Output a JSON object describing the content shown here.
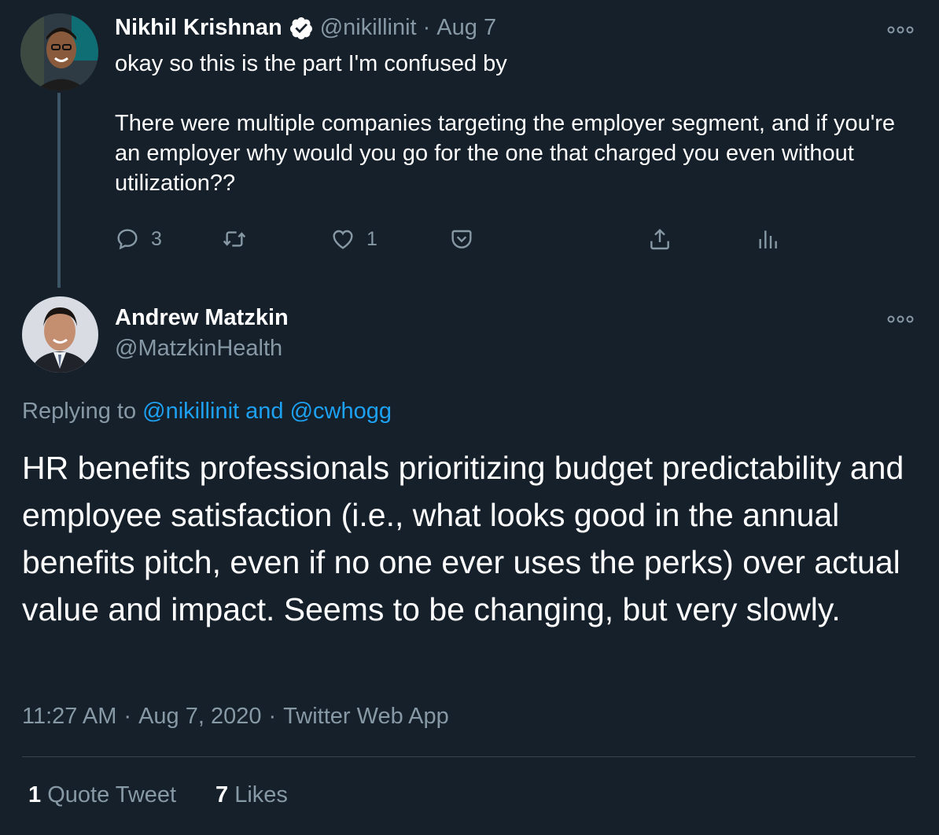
{
  "parent_tweet": {
    "author_name": "Nikhil Krishnan",
    "handle": "@nikillinit",
    "separator": "·",
    "date": "Aug 7",
    "paragraph_1": "okay so this is the part I'm confused by",
    "paragraph_2": "There were multiple companies targeting the employer segment, and if you're an employer why would you go for the one that charged you even without utilization??",
    "reply_count": "3",
    "like_count": "1"
  },
  "main_tweet": {
    "author_name": "Andrew Matzkin",
    "handle": "@MatzkinHealth",
    "replying_to_label": "Replying to",
    "reply_mentions": "@nikillinit and @cwhogg",
    "text": "HR benefits professionals prioritizing budget predictability and employee satisfaction (i.e., what looks good in the annual benefits pitch, even if no one ever uses the perks) over actual value and impact. Seems to be changing, but very slowly.",
    "time": "11:27 AM",
    "date": "Aug 7, 2020",
    "source": "Twitter Web App",
    "separator": "·",
    "quote_tweet_count": "1",
    "quote_tweet_label": "Quote Tweet",
    "likes_count": "7",
    "likes_label": "Likes"
  },
  "icons": {
    "verified": "verified-badge-icon",
    "more": "more-options-icon",
    "reply": "reply-icon",
    "retweet": "retweet-icon",
    "like": "like-icon",
    "save": "save-icon",
    "share": "share-icon",
    "analytics": "analytics-icon"
  },
  "colors": {
    "background": "#15202b",
    "text_primary": "#ffffff",
    "text_secondary": "#8899a6",
    "link": "#1da1f2",
    "divider": "#38444d",
    "thread_line": "#3d5466"
  }
}
